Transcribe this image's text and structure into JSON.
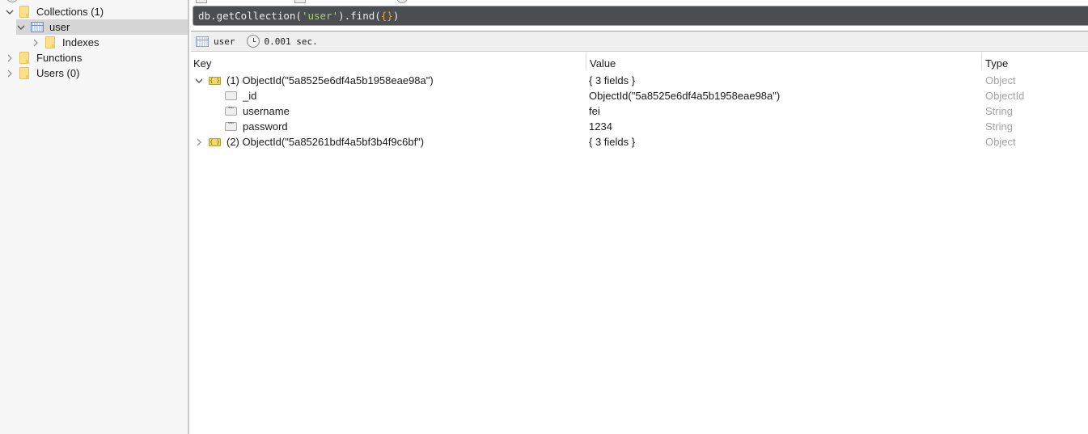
{
  "sidebar": {
    "items": [
      {
        "label": "Collections (1)",
        "icon": "folder-icon",
        "expanded": true
      },
      {
        "label": "user",
        "icon": "table-icon",
        "expanded": true,
        "selected": true
      },
      {
        "label": "Indexes",
        "icon": "folder-icon",
        "expanded": false
      },
      {
        "label": "Functions",
        "icon": "folder-icon",
        "expanded": false
      },
      {
        "label": "Users (0)",
        "icon": "folder-icon",
        "expanded": false
      }
    ]
  },
  "query": {
    "prefix": "db.getCollection(",
    "string": "'user'",
    "middle": ").find(",
    "braces": "{}",
    "suffix": ")"
  },
  "info": {
    "collection": "user",
    "time": "0.001 sec."
  },
  "grid": {
    "columns": [
      "Key",
      "Value",
      "Type"
    ],
    "rows": [
      {
        "key": "(1) ObjectId(\"5a8525e6df4a5b1958eae98a\")",
        "value": "{ 3 fields }",
        "type": "Object",
        "icon": "object-icon",
        "expander": "expanded"
      },
      {
        "key": "_id",
        "value": "ObjectId(\"5a8525e6df4a5b1958eae98a\")",
        "type": "ObjectId",
        "icon": "objectid-field-icon"
      },
      {
        "key": "username",
        "value": "fei",
        "type": "String",
        "icon": "string-field-icon"
      },
      {
        "key": "password",
        "value": "1234",
        "type": "String",
        "icon": "string-field-icon"
      },
      {
        "key": "(2) ObjectId(\"5a85261bdf4a5bf3b4f9c6bf\")",
        "value": "{ 3 fields }",
        "type": "Object",
        "icon": "object-icon",
        "expander": "collapsed"
      }
    ]
  },
  "icons": {
    "object_glyph": "{ }",
    "string_glyph": "\"\""
  }
}
